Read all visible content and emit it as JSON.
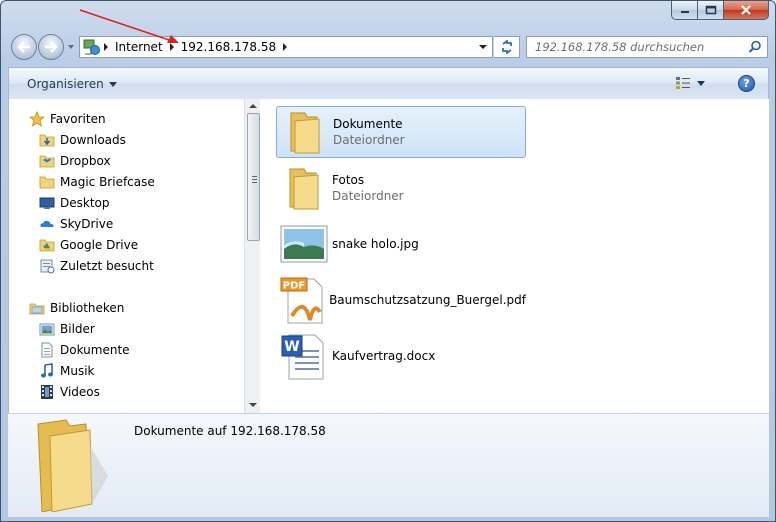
{
  "titlebar": {
    "minimize_icon": "minimize-icon",
    "maximize_icon": "maximize-icon",
    "close_icon": "close-icon"
  },
  "address_bar": {
    "crumbs": [
      "Internet",
      "192.168.178.58"
    ],
    "search_placeholder": "192.168.178.58 durchsuchen"
  },
  "toolbar": {
    "organize_label": "Organisieren"
  },
  "sidebar": {
    "favorites": {
      "label": "Favoriten",
      "items": [
        {
          "label": "Downloads",
          "icon": "downloads-folder-icon"
        },
        {
          "label": "Dropbox",
          "icon": "dropbox-icon"
        },
        {
          "label": "Magic Briefcase",
          "icon": "folder-icon"
        },
        {
          "label": "Desktop",
          "icon": "desktop-icon"
        },
        {
          "label": "SkyDrive",
          "icon": "skydrive-icon"
        },
        {
          "label": "Google Drive",
          "icon": "google-drive-icon"
        },
        {
          "label": "Zuletzt besucht",
          "icon": "recent-places-icon"
        }
      ]
    },
    "libraries": {
      "label": "Bibliotheken",
      "items": [
        {
          "label": "Bilder",
          "icon": "pictures-icon"
        },
        {
          "label": "Dokumente",
          "icon": "documents-icon"
        },
        {
          "label": "Musik",
          "icon": "music-icon"
        },
        {
          "label": "Videos",
          "icon": "videos-icon"
        }
      ]
    }
  },
  "files": [
    {
      "name": "Dokumente",
      "type": "Dateiordner",
      "icon": "folder-icon",
      "selected": true
    },
    {
      "name": "Fotos",
      "type": "Dateiordner",
      "icon": "folder-icon",
      "selected": false
    },
    {
      "name": "snake holo.jpg",
      "type": "",
      "icon": "image-file-icon",
      "selected": false
    },
    {
      "name": "Baumschutzsatzung_Buergel.pdf",
      "type": "",
      "icon": "pdf-file-icon",
      "selected": false
    },
    {
      "name": "Kaufvertrag.docx",
      "type": "",
      "icon": "word-file-icon",
      "selected": false
    }
  ],
  "details": {
    "text": "Dokumente auf 192.168.178.58"
  },
  "colors": {
    "accent": "#1e395b",
    "selection": "#cde3f7",
    "annotation_arrow": "#e0201b"
  }
}
